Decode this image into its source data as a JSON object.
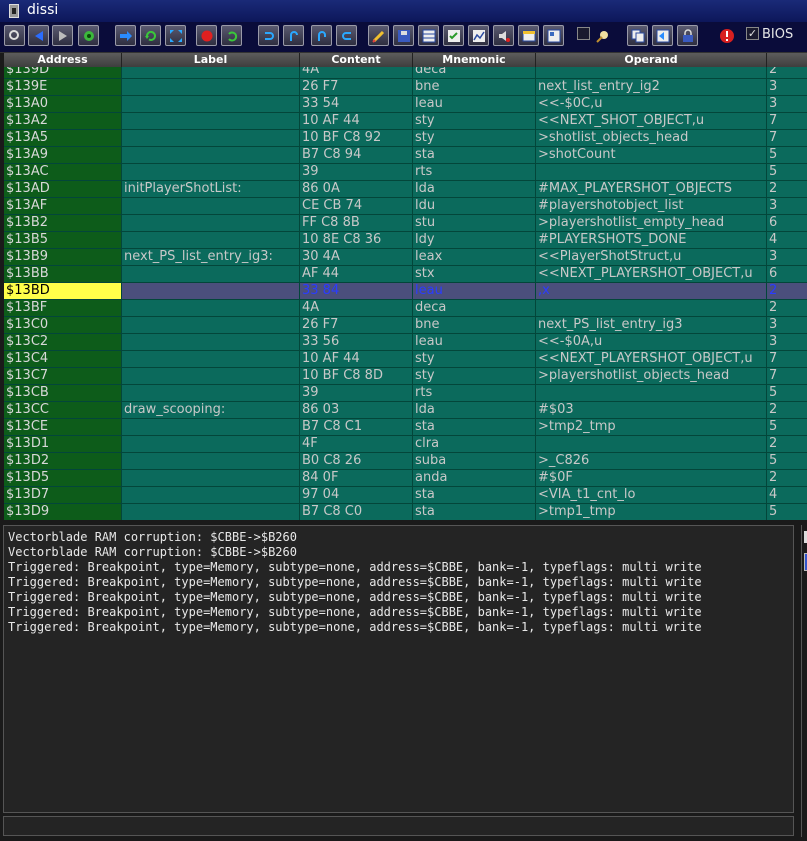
{
  "window": {
    "title": "dissi"
  },
  "toolbar": {
    "bios_label": "BIOS",
    "bios_checked": true,
    "flag_checked": false
  },
  "columns": [
    "Address",
    "Label",
    "Content",
    "Mnemonic",
    "Operand",
    ""
  ],
  "rows": [
    {
      "addr": "$139D",
      "label": "",
      "content": "4A",
      "mnem": "deca",
      "op": "",
      "cyc": "2"
    },
    {
      "addr": "$139E",
      "label": "",
      "content": "26 F7",
      "mnem": "bne",
      "op": "next_list_entry_ig2",
      "cyc": "3"
    },
    {
      "addr": "$13A0",
      "label": "",
      "content": "33 54",
      "mnem": "leau",
      "op": "<<-$0C,u",
      "cyc": "3"
    },
    {
      "addr": "$13A2",
      "label": "",
      "content": "10 AF 44",
      "mnem": "sty",
      "op": "<<NEXT_SHOT_OBJECT,u",
      "cyc": "7"
    },
    {
      "addr": "$13A5",
      "label": "",
      "content": "10 BF C8 92",
      "mnem": "sty",
      "op": ">shotlist_objects_head",
      "cyc": "7"
    },
    {
      "addr": "$13A9",
      "label": "",
      "content": "B7 C8 94",
      "mnem": "sta",
      "op": ">shotCount",
      "cyc": "5"
    },
    {
      "addr": "$13AC",
      "label": "",
      "content": "39",
      "mnem": "rts",
      "op": "",
      "cyc": "5"
    },
    {
      "addr": "$13AD",
      "label": "initPlayerShotList:",
      "content": "86 0A",
      "mnem": "lda",
      "op": "#MAX_PLAYERSHOT_OBJECTS",
      "cyc": "2"
    },
    {
      "addr": "$13AF",
      "label": "",
      "content": "CE CB 74",
      "mnem": "ldu",
      "op": "#playershotobject_list",
      "cyc": "3"
    },
    {
      "addr": "$13B2",
      "label": "",
      "content": "FF C8 8B",
      "mnem": "stu",
      "op": ">playershotlist_empty_head",
      "cyc": "6"
    },
    {
      "addr": "$13B5",
      "label": "",
      "content": "10 8E C8 36",
      "mnem": "ldy",
      "op": "#PLAYERSHOTS_DONE",
      "cyc": "4"
    },
    {
      "addr": "$13B9",
      "label": "next_PS_list_entry_ig3:",
      "content": "30 4A",
      "mnem": "leax",
      "op": "<<PlayerShotStruct,u",
      "cyc": "3"
    },
    {
      "addr": "$13BB",
      "label": "",
      "content": "AF 44",
      "mnem": "stx",
      "op": "<<NEXT_PLAYERSHOT_OBJECT,u",
      "cyc": "6"
    },
    {
      "addr": "$13BD",
      "label": "",
      "content": "33 84",
      "mnem": "leau",
      "op": ",x",
      "cyc": "2",
      "current": true
    },
    {
      "addr": "$13BF",
      "label": "",
      "content": "4A",
      "mnem": "deca",
      "op": "",
      "cyc": "2"
    },
    {
      "addr": "$13C0",
      "label": "",
      "content": "26 F7",
      "mnem": "bne",
      "op": "next_PS_list_entry_ig3",
      "cyc": "3"
    },
    {
      "addr": "$13C2",
      "label": "",
      "content": "33 56",
      "mnem": "leau",
      "op": "<<-$0A,u",
      "cyc": "3"
    },
    {
      "addr": "$13C4",
      "label": "",
      "content": "10 AF 44",
      "mnem": "sty",
      "op": "<<NEXT_PLAYERSHOT_OBJECT,u",
      "cyc": "7"
    },
    {
      "addr": "$13C7",
      "label": "",
      "content": "10 BF C8 8D",
      "mnem": "sty",
      "op": ">playershotlist_objects_head",
      "cyc": "7"
    },
    {
      "addr": "$13CB",
      "label": "",
      "content": "39",
      "mnem": "rts",
      "op": "",
      "cyc": "5"
    },
    {
      "addr": "$13CC",
      "label": "draw_scooping:",
      "content": "86 03",
      "mnem": "lda",
      "op": "#$03",
      "cyc": "2"
    },
    {
      "addr": "$13CE",
      "label": "",
      "content": "B7 C8 C1",
      "mnem": "sta",
      "op": ">tmp2_tmp",
      "cyc": "5"
    },
    {
      "addr": "$13D1",
      "label": "",
      "content": "4F",
      "mnem": "clra",
      "op": "",
      "cyc": "2"
    },
    {
      "addr": "$13D2",
      "label": "",
      "content": "B0 C8 26",
      "mnem": "suba",
      "op": ">_C826",
      "cyc": "5"
    },
    {
      "addr": "$13D5",
      "label": "",
      "content": "84 0F",
      "mnem": "anda",
      "op": "#$0F",
      "cyc": "2"
    },
    {
      "addr": "$13D7",
      "label": "",
      "content": "97 04",
      "mnem": "sta",
      "op": "<VIA_t1_cnt_lo",
      "cyc": "4"
    },
    {
      "addr": "$13D9",
      "label": "",
      "content": "B7 C8 C0",
      "mnem": "sta",
      "op": ">tmp1_tmp",
      "cyc": "5"
    }
  ],
  "console": {
    "lines": [
      "Vectorblade RAM corruption: $CBBE->$B260",
      "Vectorblade RAM corruption: $CBBE->$B260",
      "Triggered: Breakpoint, type=Memory, subtype=none, address=$CBBE, bank=-1, typeflags: multi write",
      "Triggered: Breakpoint, type=Memory, subtype=none, address=$CBBE, bank=-1, typeflags: multi write",
      "Triggered: Breakpoint, type=Memory, subtype=none, address=$CBBE, bank=-1, typeflags: multi write",
      "Triggered: Breakpoint, type=Memory, subtype=none, address=$CBBE, bank=-1, typeflags: multi write",
      "Triggered: Breakpoint, type=Memory, subtype=none, address=$CBBE, bank=-1, typeflags: multi write"
    ],
    "command_value": ""
  },
  "colors": {
    "grid_bg": "#0b6a5c",
    "addr_bg": "#0d5c1a",
    "current_addr": "#ffff4a",
    "current_row": "#4b4f7c"
  }
}
